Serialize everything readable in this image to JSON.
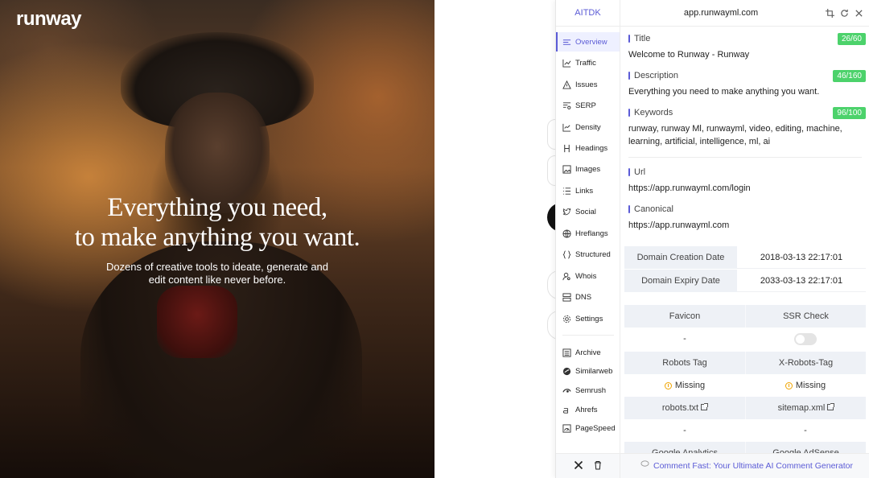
{
  "hero": {
    "logo": "runway",
    "headline_line1": "Everything you need,",
    "headline_line2": "to make anything you want.",
    "sub_line1": "Dozens of creative tools to ideate, generate and",
    "sub_line2": "edit content like never before."
  },
  "panel": {
    "brand": "AITDK",
    "domain": "app.runwayml.com",
    "header_icons": [
      "crop-icon",
      "refresh-icon",
      "close-icon"
    ],
    "sidebar": {
      "items": [
        {
          "label": "Overview",
          "icon": "overview-icon",
          "active": true
        },
        {
          "label": "Traffic",
          "icon": "traffic-icon"
        },
        {
          "label": "Issues",
          "icon": "warning-icon"
        },
        {
          "label": "SERP",
          "icon": "serp-icon"
        },
        {
          "label": "Density",
          "icon": "density-icon"
        },
        {
          "label": "Headings",
          "icon": "heading-icon"
        },
        {
          "label": "Images",
          "icon": "image-icon"
        },
        {
          "label": "Links",
          "icon": "links-icon"
        },
        {
          "label": "Social",
          "icon": "twitter-icon"
        },
        {
          "label": "Hreflangs",
          "icon": "globe-icon"
        },
        {
          "label": "Structured",
          "icon": "braces-icon"
        },
        {
          "label": "Whois",
          "icon": "user-search-icon"
        },
        {
          "label": "DNS",
          "icon": "server-icon"
        },
        {
          "label": "Settings",
          "icon": "gear-icon"
        }
      ],
      "tools": [
        {
          "label": "Archive",
          "icon": "archive-icon"
        },
        {
          "label": "Similarweb",
          "icon": "similarweb-icon"
        },
        {
          "label": "Semrush",
          "icon": "semrush-icon"
        },
        {
          "label": "Ahrefs",
          "icon": "ahrefs-icon"
        },
        {
          "label": "PageSpeed",
          "icon": "pagespeed-icon"
        }
      ]
    },
    "overview": {
      "title_label": "Title",
      "title_value": "Welcome to Runway - Runway",
      "title_count": "26/60",
      "description_label": "Description",
      "description_value": "Everything you need to make anything you want.",
      "description_count": "46/160",
      "keywords_label": "Keywords",
      "keywords_value": "runway, runway Ml, runwayml, video, editing, machine, learning, artificial, intelligence, ml, ai",
      "keywords_count": "96/100",
      "url_label": "Url",
      "url_value": "https://app.runwayml.com/login",
      "canonical_label": "Canonical",
      "canonical_value": "https://app.runwayml.com",
      "domain_creation_label": "Domain Creation Date",
      "domain_creation_value": "2018-03-13 22:17:01",
      "domain_expiry_label": "Domain Expiry Date",
      "domain_expiry_value": "2033-03-13 22:17:01",
      "favicon_label": "Favicon",
      "favicon_value": "-",
      "ssr_label": "SSR Check",
      "ssr_enabled": false,
      "robots_tag_label": "Robots Tag",
      "robots_tag_value": "Missing",
      "x_robots_label": "X-Robots-Tag",
      "x_robots_value": "Missing",
      "robots_txt_label": "robots.txt",
      "robots_txt_value": "-",
      "sitemap_label": "sitemap.xml",
      "sitemap_value": "-",
      "google_analytics_label": "Google Analytics",
      "google_adsense_label": "Google AdSense"
    },
    "footer": {
      "left_icons": [
        "x-twitter-icon",
        "trash-icon"
      ],
      "promo_text": "Comment Fast: Your Ultimate AI Comment Generator"
    }
  },
  "colors": {
    "accent": "#5b5bd6",
    "badge_green": "#4cd26b",
    "warning": "#f0a400",
    "table_header_bg": "#eef1f6"
  }
}
